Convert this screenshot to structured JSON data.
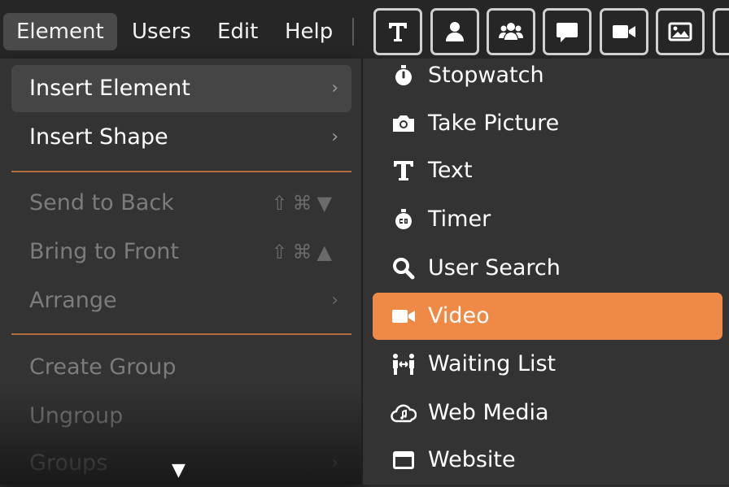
{
  "menubar": {
    "items": [
      {
        "label": "Element",
        "active": true
      },
      {
        "label": "Users",
        "active": false
      },
      {
        "label": "Edit",
        "active": false
      },
      {
        "label": "Help",
        "active": false
      }
    ],
    "tools": [
      {
        "icon": "text-tool-icon"
      },
      {
        "icon": "user-tool-icon"
      },
      {
        "icon": "users-group-tool-icon"
      },
      {
        "icon": "chat-tool-icon"
      },
      {
        "icon": "video-tool-icon"
      },
      {
        "icon": "image-tool-icon"
      }
    ]
  },
  "element_menu": {
    "items": [
      {
        "label": "Insert Element",
        "enabled": true,
        "submenu": true,
        "chevron": "›"
      },
      {
        "label": "Insert Shape",
        "enabled": true,
        "submenu": true,
        "chevron": "›"
      },
      {
        "label": "Send to Back",
        "enabled": false,
        "shortcut": "⇧⌘▼"
      },
      {
        "label": "Bring to Front",
        "enabled": false,
        "shortcut": "⇧⌘▲"
      },
      {
        "label": "Arrange",
        "enabled": false,
        "submenu": true,
        "chevron": "›"
      },
      {
        "label": "Create Group",
        "enabled": false
      },
      {
        "label": "Ungroup",
        "enabled": false
      },
      {
        "label": "Groups",
        "enabled": false,
        "submenu": true,
        "chevron": "›"
      }
    ],
    "scroll_indicator": "▼"
  },
  "insert_element_submenu": {
    "items": [
      {
        "label": "Stopwatch",
        "icon": "stopwatch-icon"
      },
      {
        "label": "Take Picture",
        "icon": "camera-icon"
      },
      {
        "label": "Text",
        "icon": "text-icon"
      },
      {
        "label": "Timer",
        "icon": "timer-icon"
      },
      {
        "label": "User Search",
        "icon": "search-icon"
      },
      {
        "label": "Video",
        "icon": "video-icon",
        "highlighted": true
      },
      {
        "label": "Waiting List",
        "icon": "waiting-list-icon"
      },
      {
        "label": "Web Media",
        "icon": "cloud-music-icon"
      },
      {
        "label": "Website",
        "icon": "browser-window-icon"
      }
    ]
  },
  "colors": {
    "highlight": "#ee8a46",
    "separator": "#b46a3a",
    "menu_bg": "#333333"
  }
}
